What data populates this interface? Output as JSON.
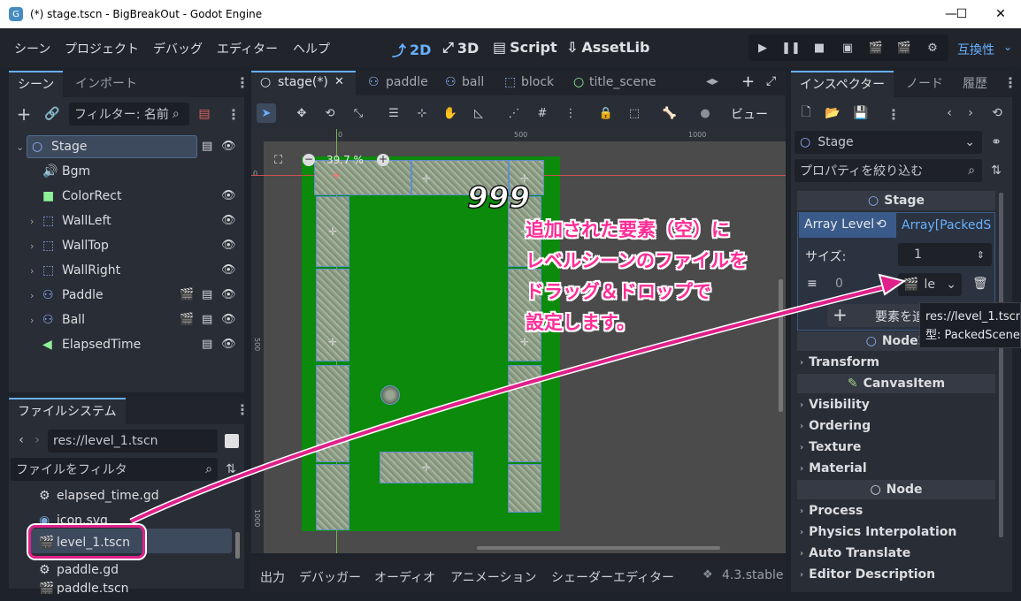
{
  "window": {
    "title": "(*) stage.tscn - BigBreakOut - Godot Engine",
    "minimize": "—",
    "maximize": "☐",
    "close": "✕"
  },
  "menu": {
    "items": [
      "シーン",
      "プロジェクト",
      "デバッグ",
      "エディター",
      "ヘルプ"
    ],
    "workspaces": [
      "2D",
      "3D",
      "Script",
      "AssetLib"
    ],
    "compat": "互換性"
  },
  "scene_dock": {
    "tabs": [
      "シーン",
      "インポート"
    ],
    "filter_placeholder": "フィルター: 名前",
    "nodes": [
      {
        "name": "Stage",
        "icon": "node2d-icon"
      },
      {
        "name": "Bgm",
        "icon": "audio-icon"
      },
      {
        "name": "ColorRect",
        "icon": "colorrect-icon"
      },
      {
        "name": "WallLeft",
        "icon": "scene-icon"
      },
      {
        "name": "WallTop",
        "icon": "scene-icon"
      },
      {
        "name": "WallRight",
        "icon": "scene-icon"
      },
      {
        "name": "Paddle",
        "icon": "character-icon"
      },
      {
        "name": "Ball",
        "icon": "character-icon"
      },
      {
        "name": "ElapsedTime",
        "icon": "label-icon"
      }
    ]
  },
  "filesystem": {
    "tab": "ファイルシステム",
    "path": "res://level_1.tscn",
    "filter_placeholder": "ファイルをフィルタ",
    "files": [
      "elapsed_time.gd",
      "icon.svg",
      "level_1.tscn",
      "paddle.gd",
      "paddle.tscn"
    ]
  },
  "editor_tabs": [
    "stage(*)",
    "paddle",
    "ball",
    "block",
    "title_scene"
  ],
  "viewport": {
    "zoom": "39.7 %",
    "score": "999",
    "ruler_top": [
      "0",
      "500",
      "1000"
    ],
    "ruler_left": [
      "0",
      "500",
      "1000"
    ],
    "view_menu": "ビュー"
  },
  "bottom_panel": {
    "tabs": [
      "出力",
      "デバッガー",
      "オーディオ",
      "アニメーション",
      "シェーダーエディター"
    ],
    "version": "4.3.stable"
  },
  "inspector": {
    "tabs": [
      "インスペクター",
      "ノード",
      "履歴"
    ],
    "object": "Stage",
    "filter_placeholder": "プロパティを絞り込む",
    "stage_section": "Stage",
    "array_level": "Array Level",
    "array_type": "Array[PackedS",
    "size_label": "サイズ:",
    "size_value": "1",
    "index": "0",
    "element_value": "le",
    "add_element": "要素を追",
    "tooltip_path": "res://level_1.tscn",
    "tooltip_type": "型: PackedScene",
    "node2d_section": "Node2",
    "rows": [
      "Transform",
      "CanvasItem",
      "Visibility",
      "Ordering",
      "Texture",
      "Material",
      "Node",
      "Process",
      "Physics Interpolation",
      "Auto Translate",
      "Editor Description"
    ]
  },
  "annotation": {
    "lines": [
      "追加された要素（空）に",
      "レベルシーンのファイルを",
      "ドラッグ＆ドロップで",
      "設定します。"
    ],
    "color": "#ff2d96"
  }
}
